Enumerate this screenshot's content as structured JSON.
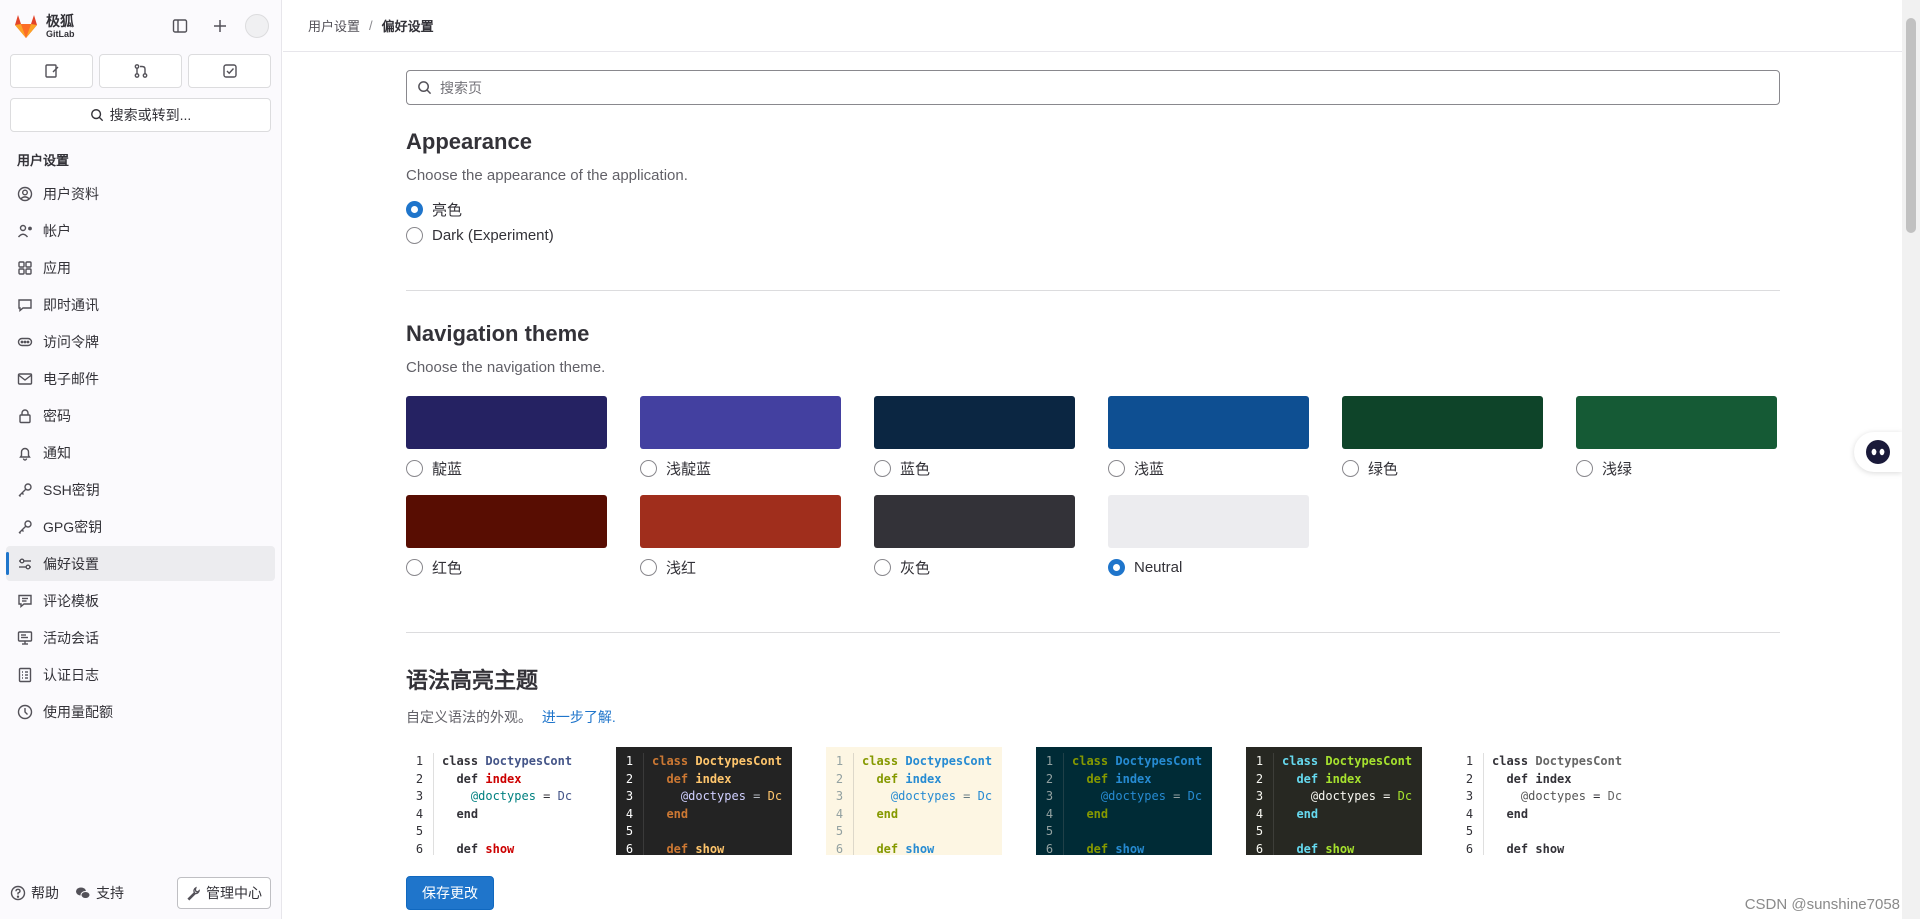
{
  "app": {
    "logo_cn": "极狐",
    "logo_en": "GitLab"
  },
  "sidebar": {
    "search_label": "搜索或转到...",
    "section_title": "用户设置",
    "items": [
      {
        "label": "用户资料",
        "icon": "profile-icon"
      },
      {
        "label": "帐户",
        "icon": "account-icon"
      },
      {
        "label": "应用",
        "icon": "applications-icon"
      },
      {
        "label": "即时通讯",
        "icon": "chat-icon"
      },
      {
        "label": "访问令牌",
        "icon": "token-icon"
      },
      {
        "label": "电子邮件",
        "icon": "mail-icon"
      },
      {
        "label": "密码",
        "icon": "lock-icon"
      },
      {
        "label": "通知",
        "icon": "bell-icon"
      },
      {
        "label": "SSH密钥",
        "icon": "key-icon"
      },
      {
        "label": "GPG密钥",
        "icon": "key-icon"
      },
      {
        "label": "偏好设置",
        "icon": "preferences-icon",
        "active": true
      },
      {
        "label": "评论模板",
        "icon": "comment-icon"
      },
      {
        "label": "活动会话",
        "icon": "monitor-icon"
      },
      {
        "label": "认证日志",
        "icon": "log-icon"
      },
      {
        "label": "使用量配额",
        "icon": "quota-icon"
      }
    ],
    "bottom": {
      "help": "帮助",
      "support": "支持",
      "admin": "管理中心"
    }
  },
  "breadcrumb": {
    "parent": "用户设置",
    "separator": "/",
    "current": "偏好设置"
  },
  "search": {
    "placeholder": "搜索页"
  },
  "appearance": {
    "title": "Appearance",
    "description": "Choose the appearance of the application.",
    "options": [
      {
        "label": "亮色",
        "checked": true
      },
      {
        "label": "Dark (Experiment)",
        "checked": false
      }
    ]
  },
  "navigation_theme": {
    "title": "Navigation theme",
    "description": "Choose the navigation theme.",
    "themes": [
      {
        "label": "靛蓝",
        "color": "#252262",
        "checked": false
      },
      {
        "label": "浅靛蓝",
        "color": "#4340a0",
        "checked": false
      },
      {
        "label": "蓝色",
        "color": "#0b2642",
        "checked": false
      },
      {
        "label": "浅蓝",
        "color": "#0e4f92",
        "checked": false
      },
      {
        "label": "绿色",
        "color": "#0e4429",
        "checked": false
      },
      {
        "label": "浅绿",
        "color": "#155a35",
        "checked": false
      },
      {
        "label": "红色",
        "color": "#580d02",
        "checked": false
      },
      {
        "label": "浅红",
        "color": "#a02e1c",
        "checked": false
      },
      {
        "label": "灰色",
        "color": "#333238",
        "checked": false
      },
      {
        "label": "Neutral",
        "color": "#ececef",
        "checked": true
      }
    ]
  },
  "syntax": {
    "title": "语法高亮主题",
    "description": "自定义语法的外观。",
    "link": "进一步了解.",
    "line_numbers": [
      "1",
      "2",
      "3",
      "4",
      "5",
      "6"
    ],
    "code_lines": [
      "class DoctypesCont",
      "  def index",
      "    @doctypes = Dc",
      "  end",
      "",
      "  def show"
    ],
    "themes": [
      {
        "bg": "#ffffff",
        "fg": "#333238",
        "gutter": "#333238",
        "kw": "#333238",
        "name": "#445588",
        "ident": "#cc0000",
        "ivar": "#008080"
      },
      {
        "bg": "#232323",
        "fg": "#b5bac0",
        "gutter": "#ffffff",
        "kw": "#cc7833",
        "name": "#ffc66d",
        "ident": "#ffc66d",
        "ivar": "#d0d0ff"
      },
      {
        "bg": "#fdf6e3",
        "fg": "#657b83",
        "gutter": "#93a1a1",
        "kw": "#859900",
        "name": "#268bd2",
        "ident": "#268bd2",
        "ivar": "#268bd2"
      },
      {
        "bg": "#002b36",
        "fg": "#93a1a1",
        "gutter": "#93a1a1",
        "kw": "#859900",
        "name": "#268bd2",
        "ident": "#268bd2",
        "ivar": "#268bd2"
      },
      {
        "bg": "#272822",
        "fg": "#f8f8f2",
        "gutter": "#f8f8f2",
        "kw": "#66d9ef",
        "name": "#a6e22e",
        "ident": "#a6e22e",
        "ivar": "#f8f8f2"
      },
      {
        "bg": "#ffffff",
        "fg": "#333238",
        "gutter": "#333238",
        "kw": "#333238",
        "name": "#666666",
        "ident": "#333238",
        "ivar": "#555555"
      }
    ]
  },
  "save_button": "保存更改",
  "watermark": "CSDN @sunshine7058"
}
